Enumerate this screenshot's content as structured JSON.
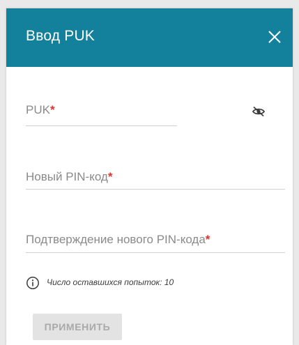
{
  "dialog": {
    "title": "Ввод PUK",
    "close_icon": "close-icon"
  },
  "fields": {
    "puk": {
      "label": "PUK",
      "required_mark": "*",
      "value": "",
      "toggle_icon": "eye-slash-icon"
    },
    "new_pin": {
      "label": "Новый PIN-код",
      "required_mark": "*",
      "value": ""
    },
    "confirm_pin": {
      "label": "Подтверждение нового PIN-кода",
      "required_mark": "*",
      "value": ""
    }
  },
  "info": {
    "icon": "info-circle-icon",
    "text": "Число оставшихся попыток: 10"
  },
  "actions": {
    "apply_label": "ПРИМЕНИТЬ",
    "apply_disabled": true
  },
  "colors": {
    "header": "#14819c",
    "required": "#e5302a",
    "disabled_button_bg": "#e3e3e3"
  }
}
